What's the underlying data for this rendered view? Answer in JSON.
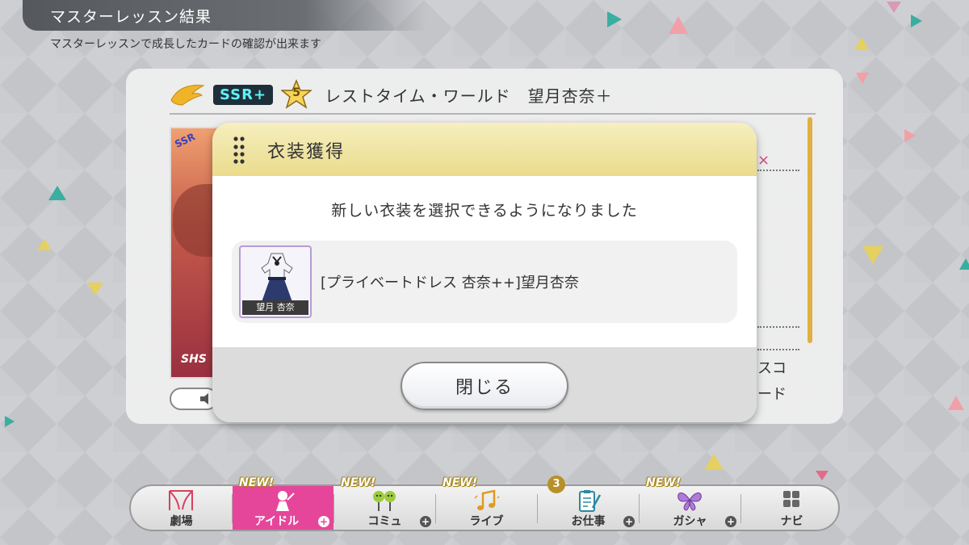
{
  "header": {
    "title": "マスターレッスン結果",
    "subtitle": "マスターレッスンで成長したカードの確認が出来ます"
  },
  "card": {
    "rarity": "SSR+",
    "star_level": "5",
    "title": "レストタイム・ワールド　望月杏奈＋",
    "art_label": "SSR",
    "art_bottom": "SHS",
    "side_text_1": "スコ",
    "side_text_2": "ード",
    "side_mark": "×"
  },
  "dialog": {
    "title": "衣装獲得",
    "message": "新しい衣装を選択できるようになりました",
    "item": {
      "thumb_name": "望月 杏奈",
      "name": "[プライベートドレス 杏奈++]望月杏奈"
    },
    "close_label": "閉じる"
  },
  "nav": {
    "items": [
      {
        "label": "劇場",
        "icon": "theater-curtain-icon"
      },
      {
        "label": "アイドル",
        "icon": "idol-icon",
        "new": "NEW!",
        "active": true
      },
      {
        "label": "コミュ",
        "icon": "commu-icon",
        "new": "NEW!"
      },
      {
        "label": "ライブ",
        "icon": "music-note-icon",
        "new": "NEW!"
      },
      {
        "label": "お仕事",
        "icon": "clipboard-icon",
        "badge": "3"
      },
      {
        "label": "ガシャ",
        "icon": "butterfly-icon",
        "new": "NEW!"
      },
      {
        "label": "ナビ",
        "icon": "grid-icon"
      }
    ],
    "plus": "+"
  },
  "colors": {
    "accent_pink": "#e6469a",
    "dialog_header": "#eadb8c",
    "rarity_text": "#5ff0f5"
  }
}
